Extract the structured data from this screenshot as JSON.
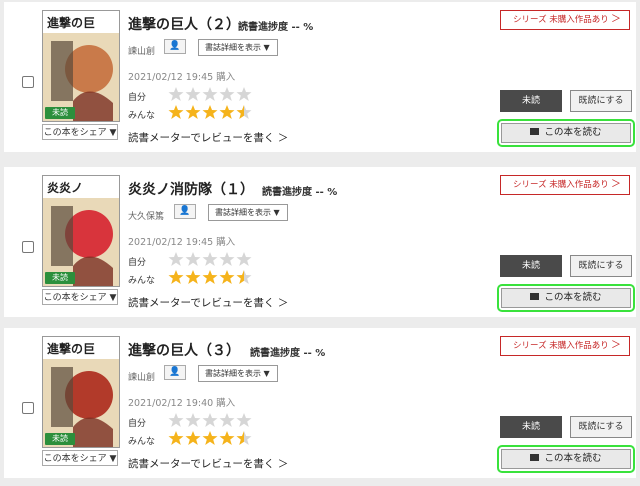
{
  "books": [
    {
      "title": "進撃の巨人（２）",
      "progress_label": "読書進捗度",
      "progress_value": "-- %",
      "author": "諫山創",
      "detail_label": "書誌詳細を表示 ▼",
      "purchase_date": "2021/02/12 19:45 購入",
      "self_label": "自分",
      "everyone_label": "みんな",
      "self_rating": 0,
      "everyone_rating": 4.5,
      "review_link": "読書メーターでレビューを書く ＞",
      "cover_badge": "未読",
      "share_label": "この本をシェア ▼",
      "series_label": "シリーズ 未購入作品あり",
      "unread_button": "未読",
      "read_status_button": "既読にする",
      "read_button": "この本を読む",
      "cover_color": "#c97a4a"
    },
    {
      "title": "炎炎ノ消防隊（１）",
      "progress_label": "読書進捗度",
      "progress_value": "-- %",
      "author": "大久保篤",
      "detail_label": "書誌詳細を表示 ▼",
      "purchase_date": "2021/02/12 19:45 購入",
      "self_label": "自分",
      "everyone_label": "みんな",
      "self_rating": 0,
      "everyone_rating": 4.5,
      "review_link": "読書メーターでレビューを書く ＞",
      "cover_badge": "未読",
      "share_label": "この本をシェア ▼",
      "series_label": "シリーズ 未購入作品あり",
      "unread_button": "未読",
      "read_status_button": "既読にする",
      "read_button": "この本を読む",
      "cover_color": "#d8343c"
    },
    {
      "title": "進撃の巨人（３）",
      "progress_label": "読書進捗度",
      "progress_value": "-- %",
      "author": "諫山創",
      "detail_label": "書誌詳細を表示 ▼",
      "purchase_date": "2021/02/12 19:40 購入",
      "self_label": "自分",
      "everyone_label": "みんな",
      "self_rating": 0,
      "everyone_rating": 4.5,
      "review_link": "読書メーターでレビューを書く ＞",
      "cover_badge": "未読",
      "share_label": "この本をシェア ▼",
      "series_label": "シリーズ 未購入作品あり",
      "unread_button": "未読",
      "read_status_button": "既読にする",
      "read_button": "この本を読む",
      "cover_color": "#b23a2a"
    }
  ],
  "icons": {
    "author": "author-profile-icon",
    "book": "book-open-icon",
    "star": "star-icon"
  },
  "colors": {
    "star_filled": "#f5b31b",
    "star_empty": "#d6d6d6",
    "series_red": "#c62828",
    "highlight_green": "#39e23c"
  }
}
